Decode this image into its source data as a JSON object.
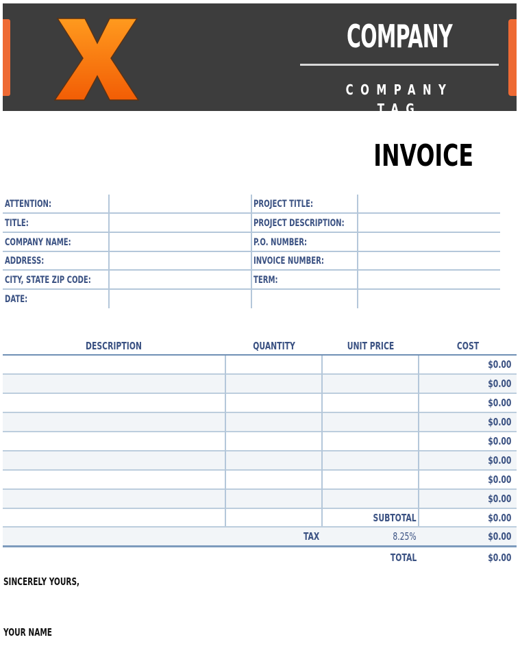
{
  "header": {
    "logo_letter": "X",
    "logo_icon": "orange-x-logo-icon",
    "company_name": "COMPANY",
    "company_tag": "COMPANY TAG",
    "accent_color": "#ee6a34",
    "band_color": "#3d3d3d"
  },
  "document": {
    "title": "INVOICE"
  },
  "info": {
    "left": [
      {
        "label": "ATTENTION:",
        "value": ""
      },
      {
        "label": "TITLE:",
        "value": ""
      },
      {
        "label": "COMPANY NAME:",
        "value": ""
      },
      {
        "label": "ADDRESS:",
        "value": ""
      },
      {
        "label": "CITY, STATE ZIP CODE:",
        "value": ""
      },
      {
        "label": "DATE:",
        "value": ""
      }
    ],
    "right": [
      {
        "label": "PROJECT TITLE:",
        "value": ""
      },
      {
        "label": "PROJECT DESCRIPTION:",
        "value": ""
      },
      {
        "label": "P.O. NUMBER:",
        "value": ""
      },
      {
        "label": "INVOICE NUMBER:",
        "value": ""
      },
      {
        "label": "TERM:",
        "value": ""
      },
      {
        "label": "",
        "value": ""
      }
    ]
  },
  "table": {
    "columns": [
      "DESCRIPTION",
      "QUANTITY",
      "UNIT PRICE",
      "COST"
    ],
    "rows": [
      {
        "description": "",
        "quantity": "",
        "unit_price": "",
        "cost": "$0.00"
      },
      {
        "description": "",
        "quantity": "",
        "unit_price": "",
        "cost": "$0.00"
      },
      {
        "description": "",
        "quantity": "",
        "unit_price": "",
        "cost": "$0.00"
      },
      {
        "description": "",
        "quantity": "",
        "unit_price": "",
        "cost": "$0.00"
      },
      {
        "description": "",
        "quantity": "",
        "unit_price": "",
        "cost": "$0.00"
      },
      {
        "description": "",
        "quantity": "",
        "unit_price": "",
        "cost": "$0.00"
      },
      {
        "description": "",
        "quantity": "",
        "unit_price": "",
        "cost": "$0.00"
      },
      {
        "description": "",
        "quantity": "",
        "unit_price": "",
        "cost": "$0.00"
      }
    ],
    "subtotal_label": "SUBTOTAL",
    "subtotal_value": "$0.00",
    "tax_label": "TAX",
    "tax_rate": "8.25%",
    "tax_value": "$0.00",
    "total_label": "TOTAL",
    "total_value": "$0.00"
  },
  "footer": {
    "closing": "SINCERELY YOURS,",
    "signature_name": "YOUR NAME"
  }
}
